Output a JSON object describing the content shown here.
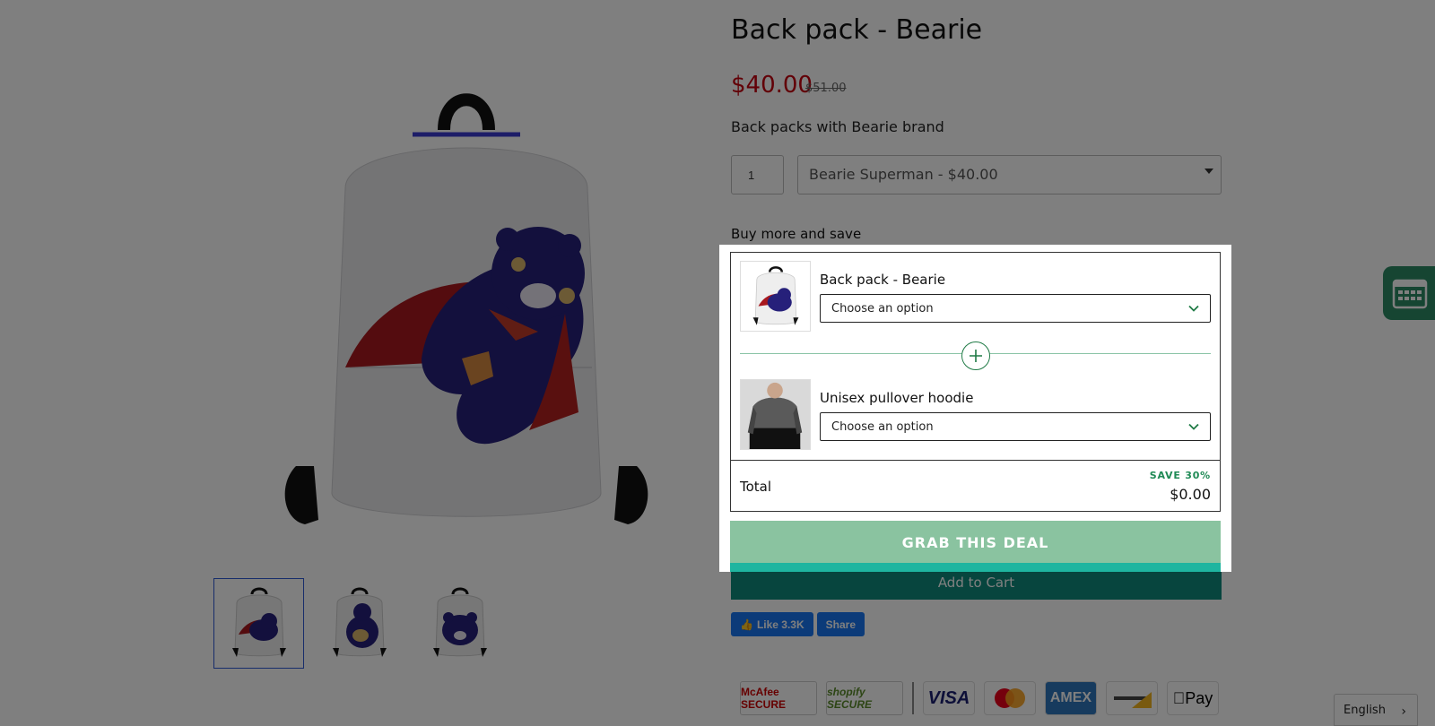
{
  "product": {
    "title": "Back pack - Bearie",
    "price": "$40.00",
    "compare_price": "$51.00",
    "description": "Back packs with Bearie brand",
    "quantity": "1",
    "variant_selected": "Bearie Superman - $40.00",
    "thumbnails": [
      "Bearie Superman",
      "Bearie variant 2",
      "Bearie variant 3"
    ]
  },
  "bundle": {
    "heading": "Buy more and save",
    "items": [
      {
        "name": "Back pack - Bearie",
        "select_placeholder": "Choose an option"
      },
      {
        "name": "Unisex pullover hoodie",
        "select_placeholder": "Choose an option"
      }
    ],
    "total_label": "Total",
    "save_label": "SAVE 30%",
    "total_value": "$0.00",
    "cta_label": "GRAB THIS DEAL"
  },
  "cart": {
    "add_to_cart_label": "Add to Cart"
  },
  "social": {
    "like_label": "Like 3.3K",
    "share_label": "Share"
  },
  "trust_badges": {
    "mcafee": "McAfee SECURE",
    "shopify": "shopify SECURE",
    "visa": "VISA",
    "amex": "AMEX",
    "apple_pay": "Pay"
  },
  "language": {
    "selected": "English"
  },
  "colors": {
    "price_red": "#c5000f",
    "accent_green": "#1f8a55",
    "cta_green": "#8ac3a0",
    "add_to_cart_teal": "#0f8a7d",
    "calendar_widget": "#2d8a64"
  },
  "icons": {
    "plus": "plus-circle-icon",
    "chevron": "chevron-down-icon",
    "calendar": "calendar-icon"
  }
}
